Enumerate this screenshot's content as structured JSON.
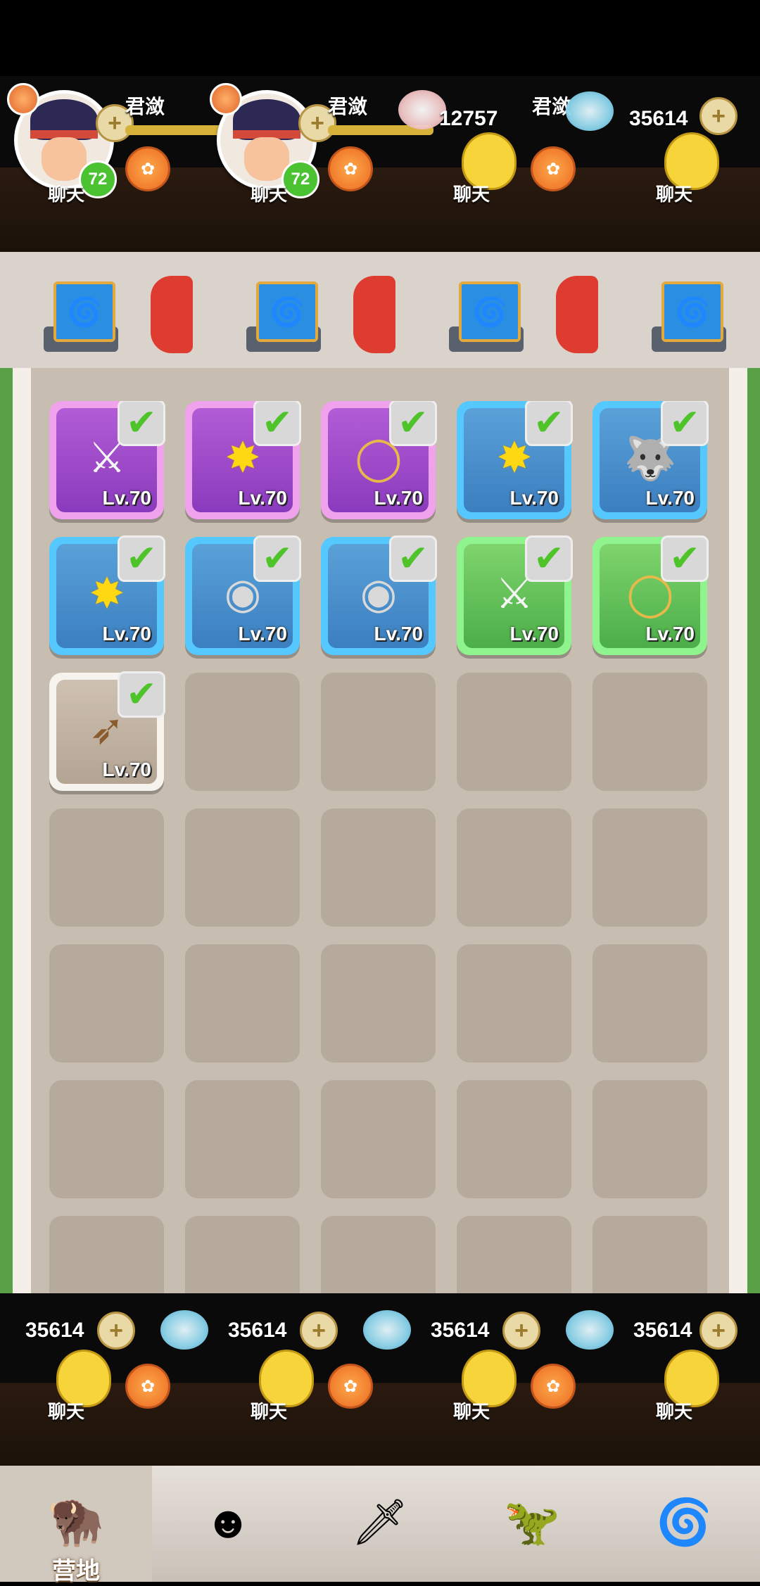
{
  "hud": {
    "player_name": "君潋",
    "level": "72",
    "chat_label": "聊天",
    "pearls": "12757",
    "gems": "35614",
    "plus_symbol": "+",
    "gift_symbol": "✿"
  },
  "inventory": {
    "check_symbol": "✔",
    "items": [
      {
        "level": "Lv.70",
        "rarity": "purple",
        "icon": "claw-gauntlet-icon",
        "glyph": "⚔"
      },
      {
        "level": "Lv.70",
        "rarity": "purple",
        "icon": "sun-burst-icon",
        "glyph": "✸"
      },
      {
        "level": "Lv.70",
        "rarity": "purple",
        "icon": "tooth-necklace-icon",
        "glyph": "◯"
      },
      {
        "level": "Lv.70",
        "rarity": "blue",
        "icon": "sun-burst-icon",
        "glyph": "✸"
      },
      {
        "level": "Lv.70",
        "rarity": "blue",
        "icon": "wolf-head-icon",
        "glyph": "🐺"
      },
      {
        "level": "Lv.70",
        "rarity": "blue",
        "icon": "sun-burst-icon",
        "glyph": "✸"
      },
      {
        "level": "Lv.70",
        "rarity": "blue",
        "icon": "stone-ring-icon",
        "glyph": "◉"
      },
      {
        "level": "Lv.70",
        "rarity": "blue",
        "icon": "stone-ring-icon",
        "glyph": "◉"
      },
      {
        "level": "Lv.70",
        "rarity": "green",
        "icon": "claw-gauntlet-icon",
        "glyph": "⚔"
      },
      {
        "level": "Lv.70",
        "rarity": "green",
        "icon": "tooth-necklace-icon",
        "glyph": "◯"
      },
      {
        "level": "Lv.70",
        "rarity": "white",
        "icon": "bow-icon",
        "glyph": "➶"
      }
    ]
  },
  "nav": {
    "items": [
      {
        "label": "营地",
        "icon": "camp-chief-icon",
        "glyph": "🦬",
        "active": true
      },
      {
        "label": "",
        "icon": "hero-icon",
        "glyph": "☻",
        "active": false
      },
      {
        "label": "",
        "icon": "equipment-icon",
        "glyph": "🗡",
        "active": false
      },
      {
        "label": "",
        "icon": "pet-dino-icon",
        "glyph": "🦖",
        "active": false
      },
      {
        "label": "",
        "icon": "totem-icon",
        "glyph": "🌀",
        "active": false
      }
    ]
  },
  "colors": {
    "purple": "#b25cd6",
    "blue": "#3b7fc0",
    "green": "#4bae48",
    "white": "#f6f3ef",
    "check_green": "#4fc42a"
  }
}
